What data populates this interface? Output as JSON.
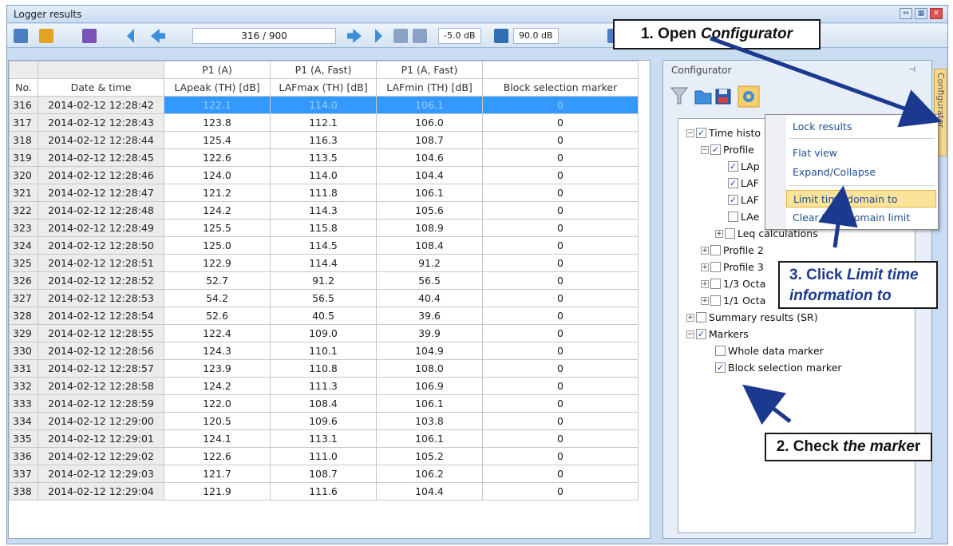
{
  "window": {
    "title": "Logger results"
  },
  "toolbar": {
    "counter": "316 / 900",
    "db_low": "-5.0 dB",
    "db_high": "90.0 dB"
  },
  "table": {
    "header_row1": [
      "",
      "",
      "P1 (A)",
      "P1 (A, Fast)",
      "P1 (A, Fast)",
      ""
    ],
    "header_row2": [
      "No.",
      "Date & time",
      "LApeak (TH) [dB]",
      "LAFmax (TH) [dB]",
      "LAFmin (TH) [dB]",
      "Block selection marker"
    ],
    "rows": [
      [
        "316",
        "2014-02-12 12:28:42",
        "122.1",
        "114.0",
        "106.1",
        "0"
      ],
      [
        "317",
        "2014-02-12 12:28:43",
        "123.8",
        "112.1",
        "106.0",
        "0"
      ],
      [
        "318",
        "2014-02-12 12:28:44",
        "125.4",
        "116.3",
        "108.7",
        "0"
      ],
      [
        "319",
        "2014-02-12 12:28:45",
        "122.6",
        "113.5",
        "104.6",
        "0"
      ],
      [
        "320",
        "2014-02-12 12:28:46",
        "124.0",
        "114.0",
        "104.4",
        "0"
      ],
      [
        "321",
        "2014-02-12 12:28:47",
        "121.2",
        "111.8",
        "106.1",
        "0"
      ],
      [
        "322",
        "2014-02-12 12:28:48",
        "124.2",
        "114.3",
        "105.6",
        "0"
      ],
      [
        "323",
        "2014-02-12 12:28:49",
        "125.5",
        "115.8",
        "108.9",
        "0"
      ],
      [
        "324",
        "2014-02-12 12:28:50",
        "125.0",
        "114.5",
        "108.4",
        "0"
      ],
      [
        "325",
        "2014-02-12 12:28:51",
        "122.9",
        "114.4",
        "91.2",
        "0"
      ],
      [
        "326",
        "2014-02-12 12:28:52",
        "52.7",
        "91.2",
        "56.5",
        "0"
      ],
      [
        "327",
        "2014-02-12 12:28:53",
        "54.2",
        "56.5",
        "40.4",
        "0"
      ],
      [
        "328",
        "2014-02-12 12:28:54",
        "52.6",
        "40.5",
        "39.6",
        "0"
      ],
      [
        "329",
        "2014-02-12 12:28:55",
        "122.4",
        "109.0",
        "39.9",
        "0"
      ],
      [
        "330",
        "2014-02-12 12:28:56",
        "124.3",
        "110.1",
        "104.9",
        "0"
      ],
      [
        "331",
        "2014-02-12 12:28:57",
        "123.9",
        "110.8",
        "108.0",
        "0"
      ],
      [
        "332",
        "2014-02-12 12:28:58",
        "124.2",
        "111.3",
        "106.9",
        "0"
      ],
      [
        "333",
        "2014-02-12 12:28:59",
        "122.0",
        "108.4",
        "106.1",
        "0"
      ],
      [
        "334",
        "2014-02-12 12:29:00",
        "120.5",
        "109.6",
        "103.8",
        "0"
      ],
      [
        "335",
        "2014-02-12 12:29:01",
        "124.1",
        "113.1",
        "106.1",
        "0"
      ],
      [
        "336",
        "2014-02-12 12:29:02",
        "122.6",
        "111.0",
        "105.2",
        "0"
      ],
      [
        "337",
        "2014-02-12 12:29:03",
        "121.7",
        "108.7",
        "106.2",
        "0"
      ],
      [
        "338",
        "2014-02-12 12:29:04",
        "121.9",
        "111.6",
        "104.4",
        "0"
      ]
    ],
    "selected_row": 0
  },
  "configurator": {
    "title": "Configurator",
    "side_tab": "Configurator",
    "tree": {
      "time_history": "Time histo",
      "profile1": "Profile",
      "lap": "LAp",
      "laf1": "LAF",
      "laf2": "LAF",
      "lae": "LAe",
      "leq": "Leq calculations",
      "profile2": "Profile 2",
      "profile3": "Profile 3",
      "oct13": "1/3 Octa",
      "oct11": "1/1 Octa",
      "summary": "Summary results (SR)",
      "markers": "Markers",
      "whole": "Whole data marker",
      "block": "Block selection marker"
    }
  },
  "context_menu": {
    "lock": "Lock results",
    "flat": "Flat view",
    "expand": "Expand/Collapse",
    "limit": "Limit time domain to",
    "clear": "Clear time domain limit"
  },
  "callouts": {
    "c1_a": "1. Open ",
    "c1_b": "Configurator",
    "c2_a": "2. Check ",
    "c2_b": "the marke",
    "c2_c": "r",
    "c3_a": "3. Click ",
    "c3_b": "Limit time",
    "c3_c": "information to"
  },
  "colors": {
    "selection": "#3399ff",
    "menu_highlight": "#fbe39a",
    "arrow": "#1b3a8f"
  }
}
